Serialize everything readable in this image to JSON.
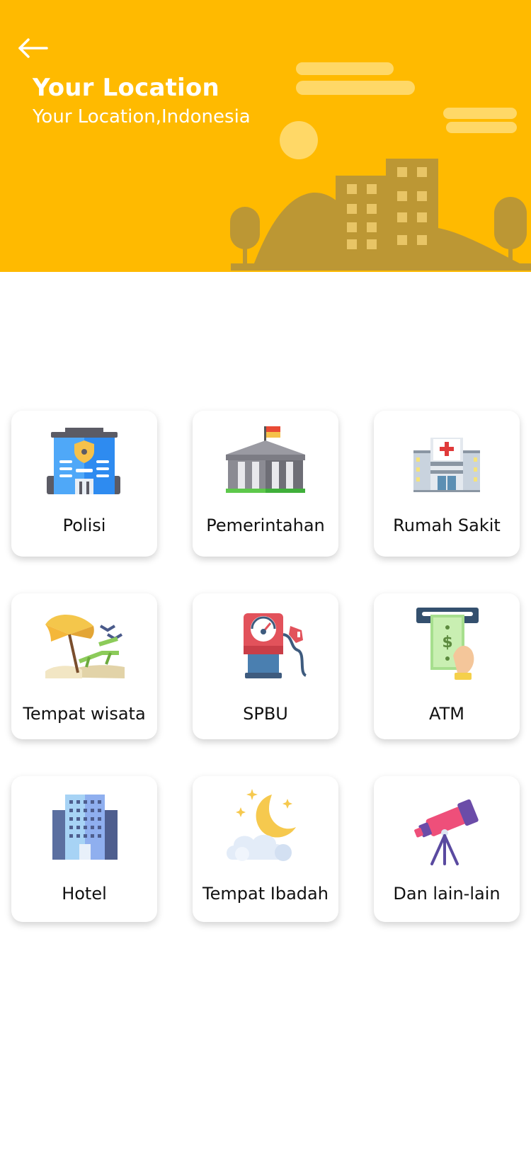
{
  "header": {
    "title": "Your Location",
    "subtitle": "Your Location,Indonesia",
    "back_icon": "arrow-left-icon",
    "background_color": "#FFBA00"
  },
  "categories": [
    {
      "label": "Polisi",
      "icon": "police-station-icon"
    },
    {
      "label": "Pemerintahan",
      "icon": "government-building-icon"
    },
    {
      "label": "Rumah Sakit",
      "icon": "hospital-icon"
    },
    {
      "label": "Tempat wisata",
      "icon": "beach-umbrella-icon"
    },
    {
      "label": "SPBU",
      "icon": "fuel-pump-icon"
    },
    {
      "label": "ATM",
      "icon": "atm-cash-icon"
    },
    {
      "label": "Hotel",
      "icon": "hotel-building-icon"
    },
    {
      "label": "Tempat Ibadah",
      "icon": "moon-cloud-icon"
    },
    {
      "label": "Dan lain-lain",
      "icon": "telescope-icon"
    }
  ]
}
